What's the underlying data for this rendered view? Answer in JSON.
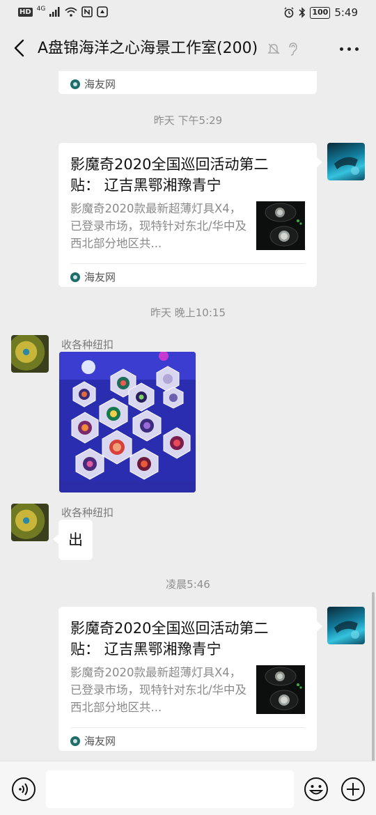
{
  "status_bar": {
    "left_labels": [
      "HD",
      "4G"
    ],
    "battery": "100",
    "time": "5:49"
  },
  "header": {
    "title": "A盘锦海洋之心海景工作室(200)"
  },
  "messages": [
    {
      "type": "card_tail",
      "source": "海友网"
    },
    {
      "type": "timestamp",
      "text": "昨天 下午5:29"
    },
    {
      "type": "link_card",
      "from": "self",
      "title": "影魔奇2020全国巡回活动第二贴： 辽吉黑鄂湘豫青宁",
      "description": "影魔奇2020款最新超薄灯具X4，已登录市场，现特针对东北/华中及西北部分地区共...",
      "source": "海友网"
    },
    {
      "type": "timestamp",
      "text": "昨天 晚上10:15"
    },
    {
      "type": "image",
      "from": "other",
      "sender": "收各种纽扣"
    },
    {
      "type": "text",
      "from": "other",
      "sender": "收各种纽扣",
      "text": "出"
    },
    {
      "type": "timestamp",
      "text": "凌晨5:46"
    },
    {
      "type": "link_card",
      "from": "self",
      "title": "影魔奇2020全国巡回活动第二贴： 辽吉黑鄂湘豫青宁",
      "description": "影魔奇2020款最新超薄灯具X4，已登录市场，现特针对东北/华中及西北部分地区共...",
      "source": "海友网"
    }
  ],
  "input": {
    "value": ""
  },
  "icons": {
    "back": "chevron-left-icon",
    "mute": "bell-off-icon",
    "ear": "ear-icon",
    "more": "more-horizontal-icon",
    "voice": "voice-icon",
    "emoji": "emoji-icon",
    "plus": "plus-icon"
  },
  "colors": {
    "background": "#ededed",
    "bubble": "#ffffff",
    "timestamp": "#8d8d8d",
    "source_logo": "#1f6d6a"
  }
}
